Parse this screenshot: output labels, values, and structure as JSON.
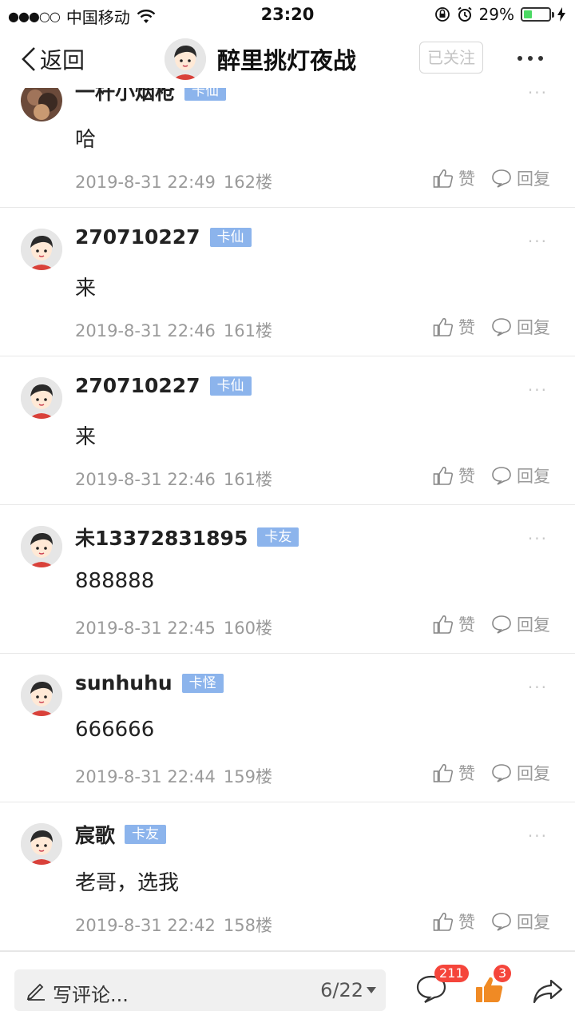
{
  "status_bar": {
    "carrier": "中国移动",
    "signal": "●●●○○",
    "time": "23:20",
    "battery_percent": "29%",
    "battery_level": 0.29,
    "battery_color": "#4cd964"
  },
  "nav": {
    "back_label": "返回",
    "title": "醉里挑灯夜战",
    "follow_label": "已关注"
  },
  "comments": [
    {
      "name": "一杆小烟枪",
      "badge": "卡仙",
      "text": "哈",
      "date": "2019-8-31 22:49",
      "floor": "162楼",
      "like_label": "赞",
      "reply_label": "回复",
      "avatar": "photo-avatar"
    },
    {
      "name": "270710227",
      "badge": "卡仙",
      "text": "来",
      "date": "2019-8-31 22:46",
      "floor": "161楼",
      "like_label": "赞",
      "reply_label": "回复",
      "avatar": "default-avatar"
    },
    {
      "name": "270710227",
      "badge": "卡仙",
      "text": "来",
      "date": "2019-8-31 22:46",
      "floor": "161楼",
      "like_label": "赞",
      "reply_label": "回复",
      "avatar": "default-avatar"
    },
    {
      "name": "未13372831895",
      "badge": "卡友",
      "text": "888888",
      "date": "2019-8-31 22:45",
      "floor": "160楼",
      "like_label": "赞",
      "reply_label": "回复",
      "avatar": "default-avatar"
    },
    {
      "name": "sunhuhu",
      "badge": "卡怪",
      "text": "666666",
      "date": "2019-8-31 22:44",
      "floor": "159楼",
      "like_label": "赞",
      "reply_label": "回复",
      "avatar": "default-avatar"
    },
    {
      "name": "宸歌",
      "badge": "卡友",
      "text": "老哥，选我",
      "date": "2019-8-31 22:42",
      "floor": "158楼",
      "like_label": "赞",
      "reply_label": "回复",
      "avatar": "default-avatar"
    }
  ],
  "bottom_bar": {
    "write_placeholder": "写评论...",
    "page_indicator": "6/22",
    "comment_count": "211",
    "like_count": "3",
    "accent_color": "#f5453b",
    "like_icon_color": "#f08a24"
  }
}
